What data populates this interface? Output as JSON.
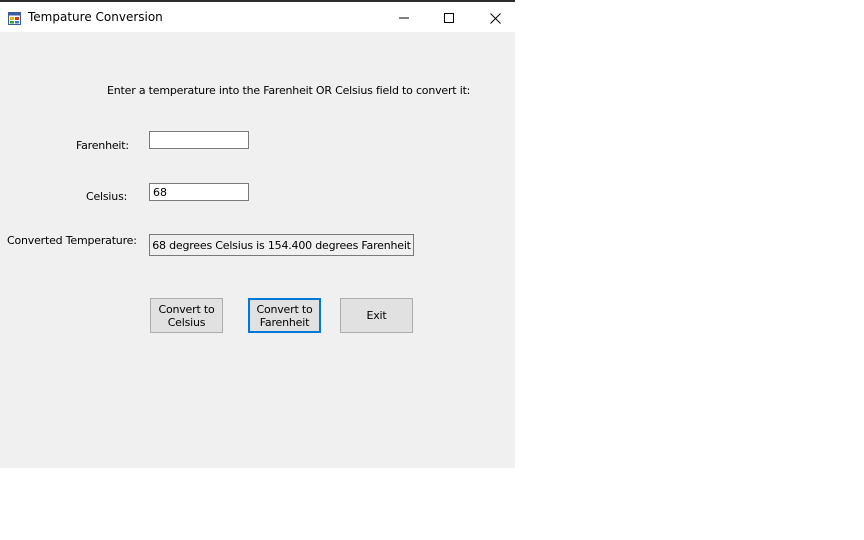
{
  "window": {
    "title": "Tempature Conversion",
    "app_icon": "form-icon",
    "controls": {
      "minimize_icon": "minimize-icon",
      "maximize_icon": "maximize-icon",
      "close_icon": "close-icon"
    }
  },
  "form": {
    "instructions": "Enter a temperature into the Farenheit OR Celsius field to convert it:",
    "farenheit_label": "Farenheit:",
    "farenheit_value": "",
    "celsius_label": "Celsius:",
    "celsius_value": "68",
    "converted_label": "Converted Temperature:",
    "converted_value": "68 degrees Celsius is 154.400 degrees Farenheit"
  },
  "buttons": {
    "to_celsius": "Convert to\nCelsius",
    "to_farenheit": "Convert to\nFarenheit",
    "exit": "Exit"
  },
  "colors": {
    "window_bg": "#f0f0f0",
    "default_button_border": "#0078d7"
  }
}
